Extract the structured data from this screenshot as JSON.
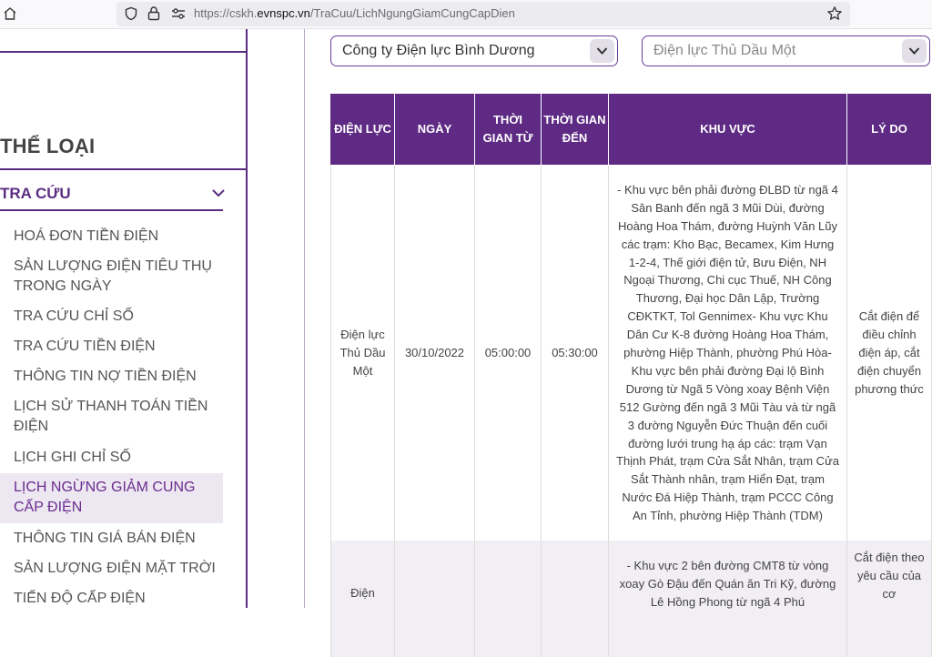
{
  "browser": {
    "url_prefix": "https://cskh.",
    "url_domain": "evnspc.vn",
    "url_path": "/TraCuu/LichNgungGiamCungCapDien",
    "icons": [
      "home-icon",
      "shield-icon",
      "lock-icon",
      "permissions-icon",
      "bookmark-star-icon"
    ]
  },
  "sidebar": {
    "heading": "THỂ LOẠI",
    "section": "TRA CỨU",
    "items": [
      "HOÁ ĐƠN TIỀN ĐIỆN",
      "SẢN LƯỢNG ĐIỆN TIÊU THỤ TRONG NGÀY",
      "TRA CỨU CHỈ SỐ",
      "TRA CỨU TIỀN ĐIỆN",
      "THÔNG TIN NỢ TIỀN ĐIỆN",
      "LỊCH SỬ THANH TOÁN TIỀN ĐIỆN",
      "LỊCH GHI CHỈ SỐ",
      "LỊCH NGỪNG GIẢM CUNG CẤP ĐIỆN",
      "THÔNG TIN GIÁ BÁN ĐIỆN",
      "SẢN LƯỢNG ĐIỆN MẶT TRỜI",
      "TIẾN ĐỘ CẤP ĐIỆN"
    ],
    "active_item": "LỊCH NGỪNG GIẢM CUNG CẤP ĐIỆN"
  },
  "filters": {
    "company": "Công ty Điện lực Bình Dương",
    "branch": "Điện lực Thủ Dầu Một"
  },
  "table": {
    "headers": [
      "ĐIỆN LỰC",
      "NGÀY",
      "THỜI GIAN TỪ",
      "THỜI GIAN ĐẾN",
      "KHU VỰC",
      "LÝ DO"
    ],
    "rows": [
      {
        "dien_luc": "Điện lực Thủ Dầu Một",
        "ngay": "30/10/2022",
        "tu": "05:00:00",
        "den": "05:30:00",
        "khu_vuc": "- Khu vực bên phải đường ĐLBD từ ngã 4 Sân Banh đến ngã 3 Mũi Dùi, đường Hoàng Hoa Thám, đường Huỳnh Văn Lũy các trạm: Kho Bạc, Becamex, Kim Hưng 1-2-4, Thế giới điện tử, Bưu Điện, NH Ngoại Thương, Chi cục Thuế, NH Công Thương, Đại học Dân Lập, Trường CĐKTKT, Tol Gennimex- Khu vực Khu Dân Cư K-8 đường Hoàng Hoa Thám, phường Hiệp Thành, phường Phú Hòa- Khu vực bên phải đường Đại lộ Bình Dương từ Ngã 5 Vòng xoay Bệnh Viện 512 Gường đến ngã 3 Mũi Tàu và từ ngã 3 đường Nguyễn Đức Thuận đến cuối đường lưới trung hạ áp các: trạm Vạn Thịnh Phát, trạm Cửa Sắt Nhân, trạm Cửa Sắt Thành nhân, trạm Hiển Đạt, trạm Nước Đá Hiệp Thành, trạm PCCC Công An Tỉnh, phường Hiệp Thành (TDM)",
        "ly_do": "Cắt điện để điều chỉnh điện áp, cắt điện chuyển phương thức"
      },
      {
        "dien_luc": "Điện",
        "ngay": "",
        "tu": "",
        "den": "",
        "khu_vuc": "- Khu vực 2 bên đường CMT8 từ vòng xoay Gò Đậu đến Quán ăn Tri Kỹ, đường Lê Hồng Phong từ ngã 4 Phú",
        "ly_do": "Cắt điện theo yêu cầu của cơ"
      }
    ]
  },
  "colors": {
    "brand_purple": "#5e2a84",
    "active_bg": "#ece7f0",
    "row_alt_bg": "#f1eef4"
  }
}
